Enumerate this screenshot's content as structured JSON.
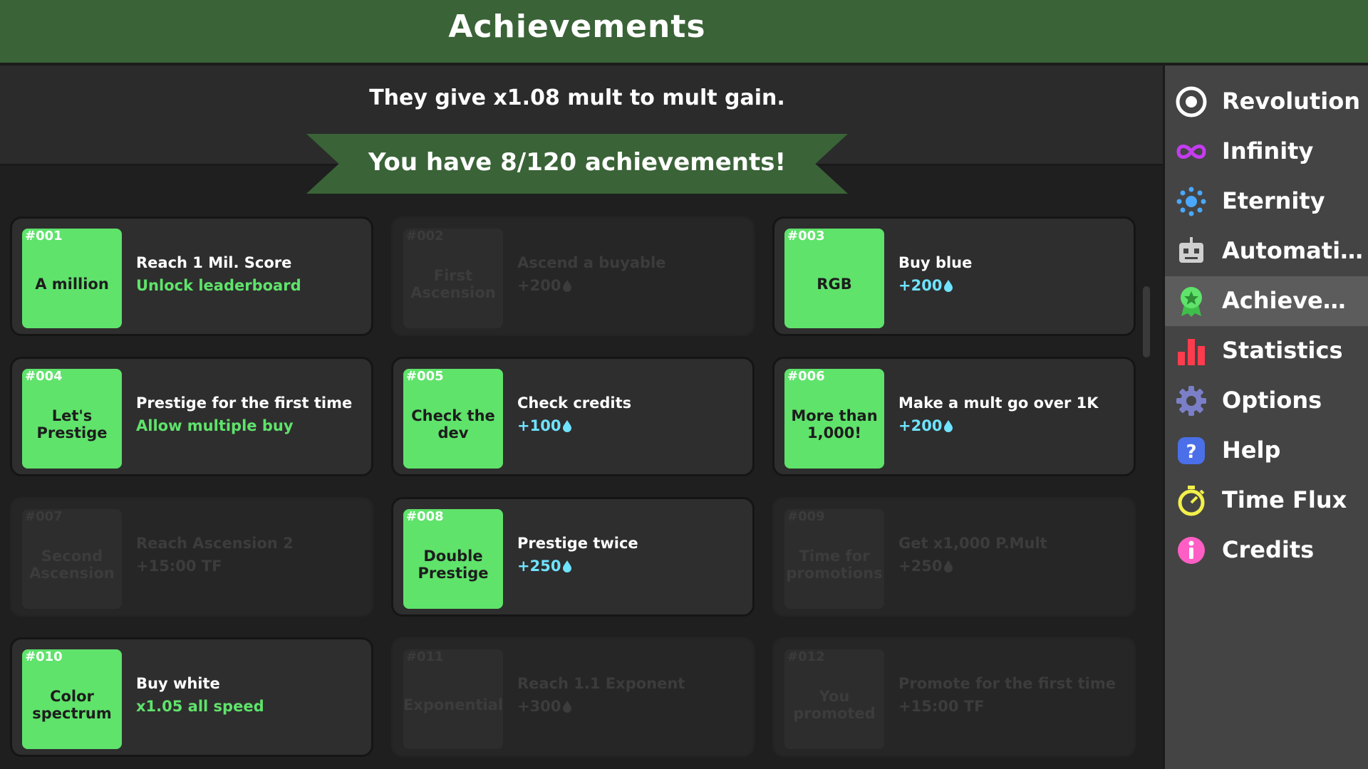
{
  "header": {
    "title": "Achievements"
  },
  "info": {
    "mult_text": "They give x1.08 mult to mult gain.",
    "progress_text": "You have 8/120 achievements!"
  },
  "achievements": [
    {
      "num": "#001",
      "name": "A million",
      "desc": "Reach 1 Mil. Score",
      "reward": "Unlock leaderboard",
      "reward_type": "text",
      "unlocked": true
    },
    {
      "num": "#002",
      "name": "First Ascension",
      "desc": "Ascend a buyable",
      "reward": "+200",
      "reward_type": "drop",
      "unlocked": false
    },
    {
      "num": "#003",
      "name": "RGB",
      "desc": "Buy blue",
      "reward": "+200",
      "reward_type": "drop",
      "unlocked": true
    },
    {
      "num": "#004",
      "name": "Let's Prestige",
      "desc": "Prestige for the first time",
      "reward": "Allow multiple buy",
      "reward_type": "text",
      "unlocked": true
    },
    {
      "num": "#005",
      "name": "Check the dev",
      "desc": "Check credits",
      "reward": "+100",
      "reward_type": "drop",
      "unlocked": true
    },
    {
      "num": "#006",
      "name": "More than 1,000!",
      "desc": "Make a mult go over 1K",
      "reward": "+200",
      "reward_type": "drop",
      "unlocked": true
    },
    {
      "num": "#007",
      "name": "Second Ascension",
      "desc": "Reach Ascension 2",
      "reward": "+15:00 TF",
      "reward_type": "text",
      "unlocked": false
    },
    {
      "num": "#008",
      "name": "Double Prestige",
      "desc": "Prestige twice",
      "reward": "+250",
      "reward_type": "drop",
      "unlocked": true
    },
    {
      "num": "#009",
      "name": "Time for promotions",
      "desc": "Get x1,000 P.Mult",
      "reward": "+250",
      "reward_type": "drop",
      "unlocked": false
    },
    {
      "num": "#010",
      "name": "Color spectrum",
      "desc": "Buy white",
      "reward": "x1.05 all speed",
      "reward_type": "text",
      "unlocked": true
    },
    {
      "num": "#011",
      "name": "Exponential",
      "desc": "Reach 1.1 Exponent",
      "reward": "+300",
      "reward_type": "drop",
      "unlocked": false
    },
    {
      "num": "#012",
      "name": "You promoted",
      "desc": "Promote for the first time",
      "reward": "+15:00 TF",
      "reward_type": "text",
      "unlocked": false
    }
  ],
  "sidebar": {
    "items": [
      {
        "label": "Revolution",
        "icon": "revolution-icon"
      },
      {
        "label": "Infinity",
        "icon": "infinity-icon"
      },
      {
        "label": "Eternity",
        "icon": "eternity-icon"
      },
      {
        "label": "Automations",
        "icon": "robot-icon"
      },
      {
        "label": "Achievem...",
        "icon": "medal-icon",
        "active": true
      },
      {
        "label": "Statistics",
        "icon": "bar-chart-icon"
      },
      {
        "label": "Options",
        "icon": "gear-icon"
      },
      {
        "label": "Help",
        "icon": "question-icon"
      },
      {
        "label": "Time Flux",
        "icon": "stopwatch-icon"
      },
      {
        "label": "Credits",
        "icon": "info-icon"
      }
    ]
  },
  "colors": {
    "header_green": "#3a6337",
    "unlocked_tile": "#5fe36b",
    "reward_text_green": "#5fe36b",
    "reward_cyan": "#6fe3ff",
    "sidebar_bg": "#444444",
    "sidebar_active": "#5c5c5c"
  }
}
